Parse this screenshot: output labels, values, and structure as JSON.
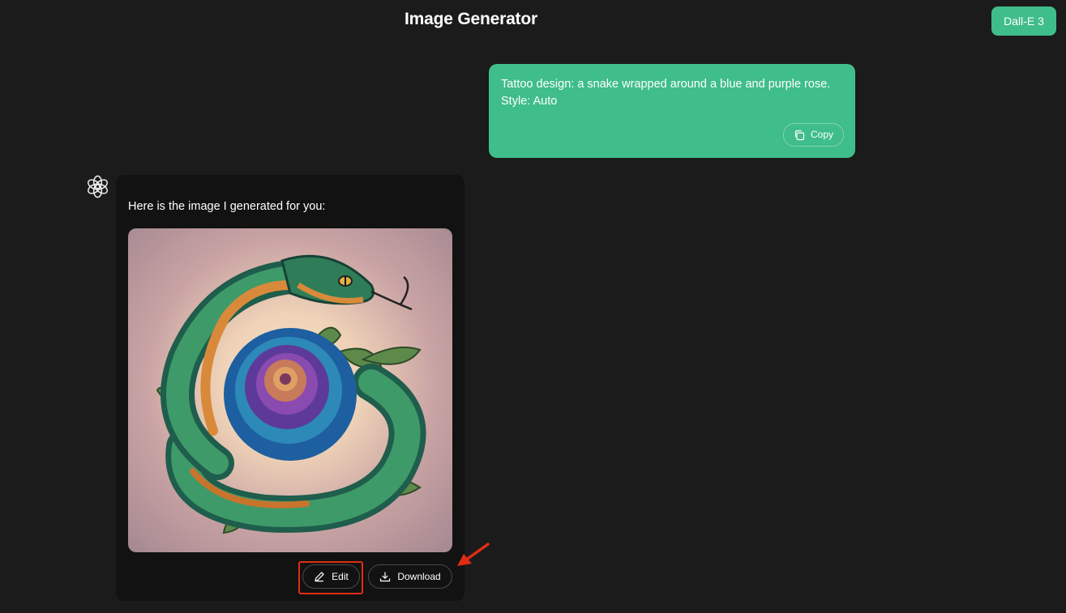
{
  "header": {
    "title": "Image Generator",
    "model_label": "Dall-E 3"
  },
  "user_message": {
    "lines": [
      "Tattoo design: a snake wrapped around a blue and purple rose.",
      "Style: Auto"
    ],
    "copy_label": "Copy"
  },
  "assistant_message": {
    "text": "Here is the image I generated for you:",
    "edit_label": "Edit",
    "download_label": "Download"
  },
  "colors": {
    "accent": "#3fbd8a",
    "background": "#1b1b1b",
    "bubble": "#121212",
    "annotation": "#e02d12"
  },
  "icons": [
    "openai-logo-icon",
    "copy-icon",
    "pencil-icon",
    "download-icon"
  ]
}
